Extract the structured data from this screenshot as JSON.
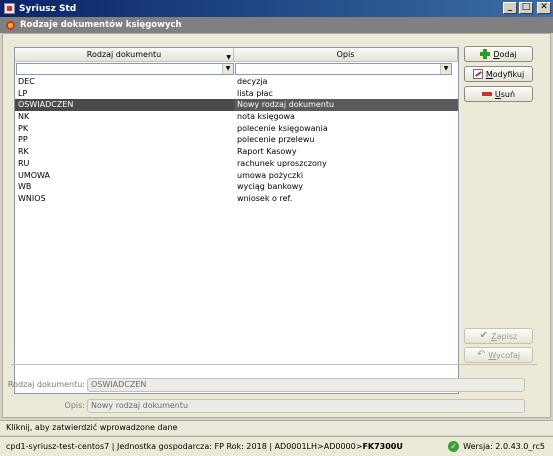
{
  "window": {
    "title": "Syriusz Std",
    "min_label": "_",
    "max_label": "□",
    "close_label": "✕"
  },
  "form": {
    "title": "Rodzaje dokumentów księgowych"
  },
  "grid": {
    "columns": [
      "Rodzaj dokumentu",
      "Opis"
    ],
    "rows": [
      {
        "code": "DEC",
        "desc": "decyzja"
      },
      {
        "code": "LP",
        "desc": "lista płac"
      },
      {
        "code": "OSWIADCZEN",
        "desc": "Nowy rodzaj dokumentu",
        "selected": true
      },
      {
        "code": "NK",
        "desc": "nota księgowa"
      },
      {
        "code": "PK",
        "desc": "polecenie księgowania"
      },
      {
        "code": "PP",
        "desc": "polecenie przelewu"
      },
      {
        "code": "RK",
        "desc": "Raport Kasowy"
      },
      {
        "code": "RU",
        "desc": "rachunek uproszczony"
      },
      {
        "code": "UMOWA",
        "desc": "umowa pożyczki"
      },
      {
        "code": "WB",
        "desc": "wyciąg bankowy"
      },
      {
        "code": "WNIOS",
        "desc": "wniosek o ref."
      }
    ]
  },
  "buttons": {
    "add_first": "D",
    "add_rest": "odaj",
    "modify_first": "M",
    "modify_rest": "odyfikuj",
    "delete_first": "U",
    "delete_rest": "suń",
    "save_first": "Z",
    "save_rest": "apisz",
    "undo_first": "W",
    "undo_rest": "ycofaj"
  },
  "details": {
    "type_label": "Rodzaj dokumentu:",
    "type_value": "OSWIADCZEN",
    "desc_label": "Opis:",
    "desc_value": "Nowy rodzaj dokumentu"
  },
  "hint": "Kliknij, aby zatwierdzić wprowadzone dane",
  "status": {
    "left_plain": "cpd1-syriusz-test-centos7 | Jednostka gospodarcza: FP Rok: 2018 | AD0001LH>AD0000>",
    "left_bold": "FK7300U",
    "version": "Wersja: 2.0.43.0_rc5"
  },
  "icons": {
    "add": "plus-icon",
    "modify": "edit-icon",
    "delete": "minus-icon",
    "save": "check-icon",
    "undo": "undo-icon",
    "status_ok": "check-circle-icon"
  }
}
